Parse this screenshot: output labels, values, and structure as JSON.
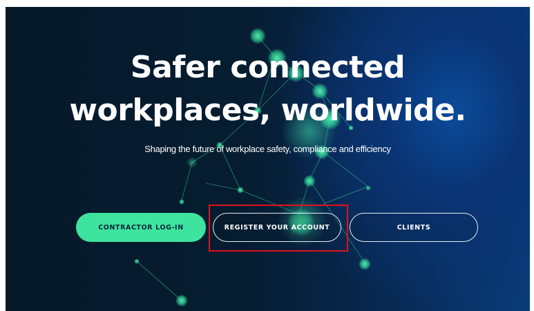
{
  "hero": {
    "headline_line1": "Safer connected",
    "headline_line2": "workplaces, worldwide.",
    "subtitle": "Shaping the future of workplace safety, compliance and efficiency"
  },
  "buttons": {
    "contractor_login": "CONTRACTOR LOG-IN",
    "register_account": "REGISTER YOUR ACCOUNT",
    "clients": "CLIENTS"
  },
  "colors": {
    "background_dark": "#061a2a",
    "background_blue": "#0a3c7a",
    "accent_green": "#3ee3a0",
    "highlight_red": "#e0121b"
  },
  "icons": [
    "network-graphic"
  ]
}
